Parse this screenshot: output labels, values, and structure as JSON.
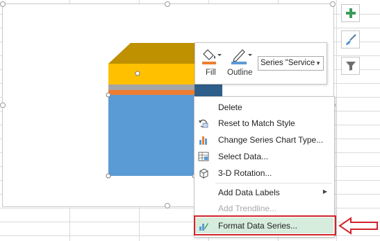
{
  "colors": {
    "series_top": "#ffc000",
    "series_top_face": "#bf9000",
    "series_mid": "#a5a5a5",
    "series_orange": "#ed7d31",
    "series_blue": "#5b9bd5",
    "series_blue_dark": "#2e5f8a",
    "highlight": "#d6ecdc",
    "callout": "#d3222a",
    "accent_green": "#3a9c5a"
  },
  "side_buttons": [
    {
      "name": "chart-elements-button",
      "icon": "plus-icon"
    },
    {
      "name": "chart-styles-button",
      "icon": "paintbrush-icon"
    },
    {
      "name": "chart-filters-button",
      "icon": "funnel-icon"
    }
  ],
  "mini_toolbar": {
    "fill_label": "Fill",
    "outline_label": "Outline",
    "series_selector_value": "Series \"Service"
  },
  "context_menu": {
    "items": [
      {
        "label": "Delete",
        "icon": "none",
        "enabled": true
      },
      {
        "label": "Reset to Match Style",
        "icon": "reset-style-icon",
        "enabled": true
      },
      {
        "label": "Change Series Chart Type...",
        "icon": "bar-chart-icon",
        "enabled": true
      },
      {
        "label": "Select Data...",
        "icon": "select-data-icon",
        "enabled": true
      },
      {
        "label": "3-D Rotation...",
        "icon": "3d-rotation-icon",
        "enabled": true
      },
      {
        "label": "Add Data Labels",
        "icon": "none",
        "enabled": true,
        "submenu": true
      },
      {
        "label": "Add Trendline...",
        "icon": "none",
        "enabled": false
      },
      {
        "label": "Format Data Series...",
        "icon": "format-series-icon",
        "enabled": true,
        "highlighted": true
      }
    ]
  }
}
